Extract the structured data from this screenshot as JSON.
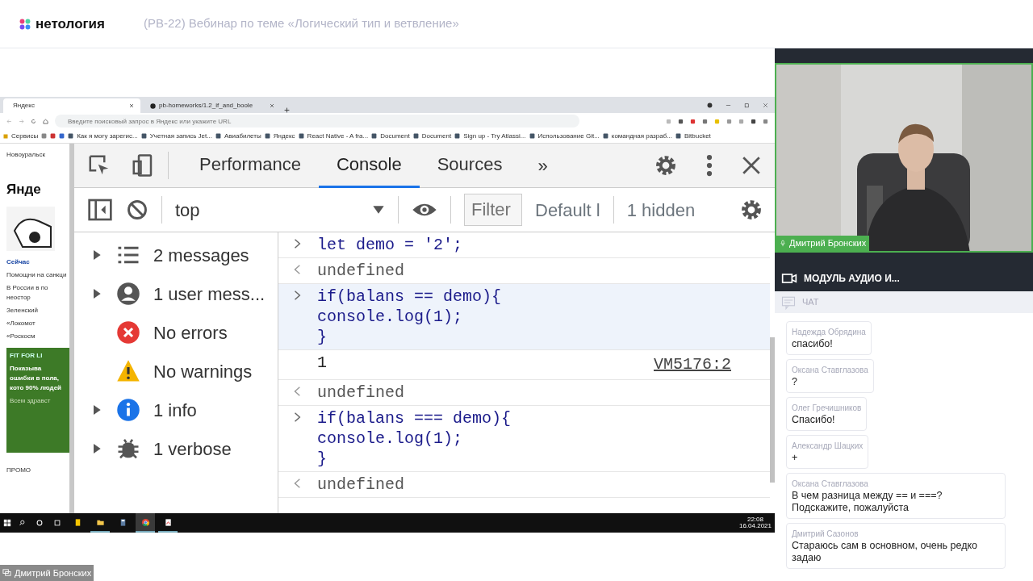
{
  "header": {
    "logo": "нетология",
    "title": "(PB-22) Вебинар по теме «Логический тип и ветвление»"
  },
  "share": {
    "browser_tabs": [
      {
        "label": "Яндекс",
        "selected": true
      },
      {
        "label": "pb-homeworks/1.2_if_and_boole",
        "selected": false
      }
    ],
    "address": {
      "placeholder": "Введите поисковый запрос в Яндекс или укажите URL"
    },
    "bookmarks": [
      "Сервисы",
      "Как я могу зарегис...",
      "Учетная запись Jet...",
      "Авиабилеты",
      "Яндекс",
      "React Native - A fra...",
      "Document",
      "Document",
      "Sign up - Try Atlassi...",
      "Использование Git...",
      "командная разраб...",
      "Bitbucket"
    ],
    "page": {
      "location": "Новоуральск",
      "logo": "Янде",
      "news_title": "Сейчас",
      "news": [
        "Помощни на санкци",
        "В России в по неостор",
        "Зеленский",
        "«Локомот",
        "«Роскосм"
      ],
      "ad": {
        "tag": "FIT FOR LI",
        "text": "Показыва ошибки в пола, кото 90% людей",
        "sub": "Всем здравст"
      },
      "promo": "ПРОМО"
    },
    "devtools": {
      "tabs": [
        {
          "label": "Performance",
          "selected": false
        },
        {
          "label": "Console",
          "selected": true
        },
        {
          "label": "Sources",
          "selected": false
        }
      ],
      "more": "»",
      "context": "top",
      "filter": {
        "placeholder": "Filter"
      },
      "levels": "Default l",
      "hidden": "1 hidden",
      "sidebar": [
        {
          "kind": "messages",
          "label": "2 messages",
          "expandable": true
        },
        {
          "kind": "user",
          "label": "1 user mess...",
          "expandable": true
        },
        {
          "kind": "error",
          "label": "No errors",
          "expandable": false
        },
        {
          "kind": "warning",
          "label": "No warnings",
          "expandable": false
        },
        {
          "kind": "info",
          "label": "1 info",
          "expandable": true
        },
        {
          "kind": "verbose",
          "label": "1 verbose",
          "expandable": true
        }
      ],
      "console": [
        {
          "kind": "input",
          "lines": [
            "let demo = '2';"
          ],
          "highlighted": false
        },
        {
          "kind": "result",
          "lines": [
            "undefined"
          ],
          "highlighted": false
        },
        {
          "kind": "input",
          "lines": [
            "if(balans == demo){",
            "console.log(1);",
            "}"
          ],
          "highlighted": true
        },
        {
          "kind": "log",
          "lines": [
            "1"
          ],
          "source": "VM5176:2",
          "highlighted": false
        },
        {
          "kind": "result",
          "lines": [
            "undefined"
          ],
          "highlighted": false
        },
        {
          "kind": "input",
          "lines": [
            "if(balans === demo){",
            "console.log(1);",
            "}"
          ],
          "highlighted": false
        },
        {
          "kind": "result",
          "lines": [
            "undefined"
          ],
          "highlighted": false
        }
      ]
    },
    "taskbar": {
      "apps": [
        {
          "kind": "notes",
          "running": false,
          "selected": false
        },
        {
          "kind": "folder",
          "running": true,
          "selected": false
        },
        {
          "kind": "calculator",
          "running": false,
          "selected": false
        },
        {
          "kind": "chrome",
          "running": true,
          "selected": true
        },
        {
          "kind": "pdf",
          "running": true,
          "selected": false
        }
      ],
      "time": "22:08",
      "date": "16.04.2021"
    }
  },
  "presenter_tag": "Дмитрий Бронских",
  "webcam": {
    "name": "Дмитрий Бронских",
    "mic_on": true
  },
  "module": "МОДУЛЬ АУДИО И...",
  "chat": {
    "title": "ЧАТ",
    "messages": [
      {
        "author": "Надежда Обрядина",
        "text": "спасибо!"
      },
      {
        "author": "Оксана Ставглазова",
        "text": "?"
      },
      {
        "author": "Олег Гречишников",
        "text": "Спасибо!"
      },
      {
        "author": "Александр Шацких",
        "text": "+"
      },
      {
        "author": "Оксана Ставглазова",
        "text": "В чем разница между == и ===? Подскажите, пожалуйста"
      },
      {
        "author": "Дмитрий Сазонов",
        "text": "Стараюсь сам в основном, очень редко задаю"
      }
    ]
  }
}
